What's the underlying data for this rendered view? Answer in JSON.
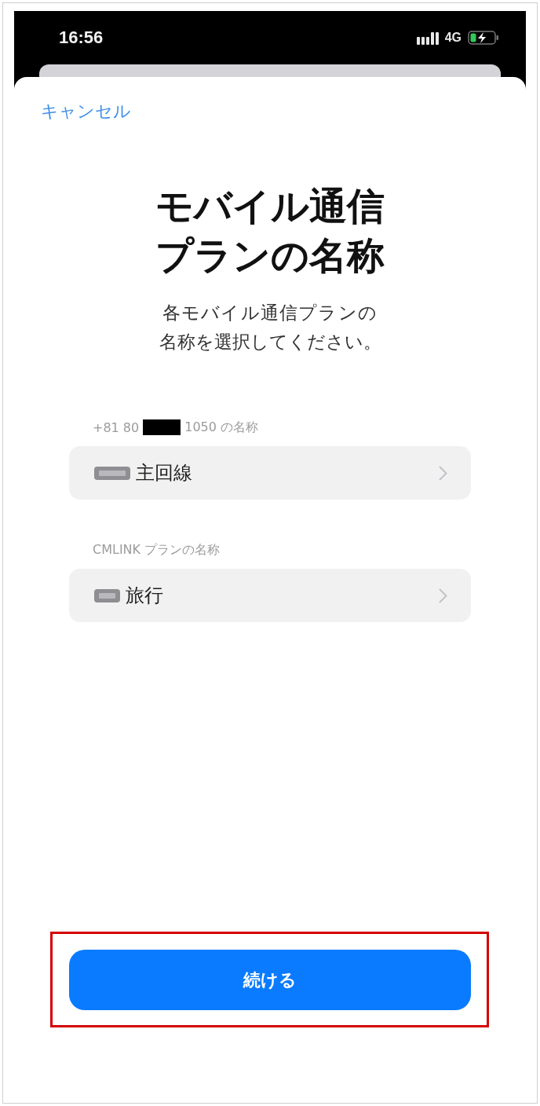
{
  "status_bar": {
    "time": "16:56",
    "network": "4G"
  },
  "nav": {
    "cancel": "キャンセル"
  },
  "header": {
    "title": "モバイル通信プランの名称",
    "subtitle": "各モバイル通信プランの名称を選択してください。"
  },
  "plans": [
    {
      "label_before": "+81 80",
      "redacted": true,
      "label_after": "1050 の名称",
      "value": "主回線"
    },
    {
      "label_before": "CMLINK プランの名称",
      "redacted": false,
      "value": "旅行"
    }
  ],
  "continue_button": {
    "label": "続ける",
    "highlighted": true
  }
}
